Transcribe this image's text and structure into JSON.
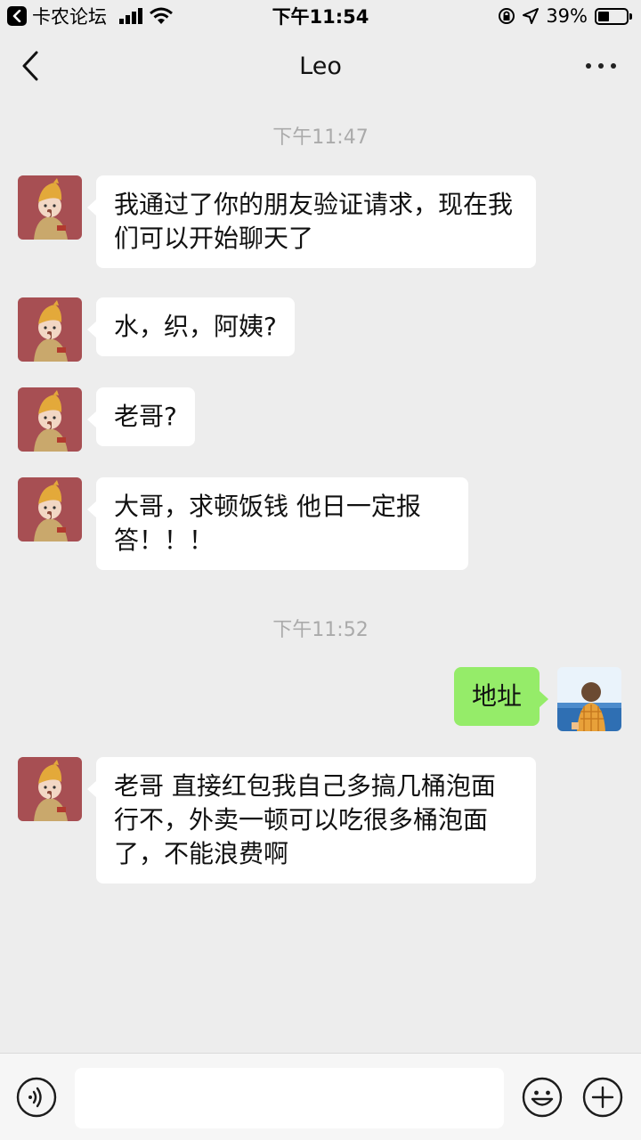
{
  "status_bar": {
    "back_app_label": "卡农论坛",
    "time": "下午11:54",
    "battery_text": "39%",
    "battery_level": 0.39
  },
  "nav": {
    "title": "Leo"
  },
  "chat": {
    "timestamps": [
      "下午11:47",
      "下午11:52"
    ],
    "messages": [
      {
        "side": "left",
        "text": "我通过了你的朋友验证请求，现在我们可以开始聊天了"
      },
      {
        "side": "left",
        "text": "水，织，阿姨?"
      },
      {
        "side": "left",
        "text": "老哥?"
      },
      {
        "side": "left",
        "text": "大哥，求顿饭钱  他日一定报答！！！"
      },
      {
        "side": "right",
        "text": "地址"
      },
      {
        "side": "left",
        "text": "老哥 直接红包我自己多搞几桶泡面行不，外卖一顿可以吃很多桶泡面了，不能浪费啊"
      }
    ]
  },
  "input_bar": {
    "value": "",
    "placeholder": ""
  },
  "colors": {
    "background": "#ededed",
    "bubble_incoming": "#ffffff",
    "bubble_outgoing": "#95ec69"
  }
}
